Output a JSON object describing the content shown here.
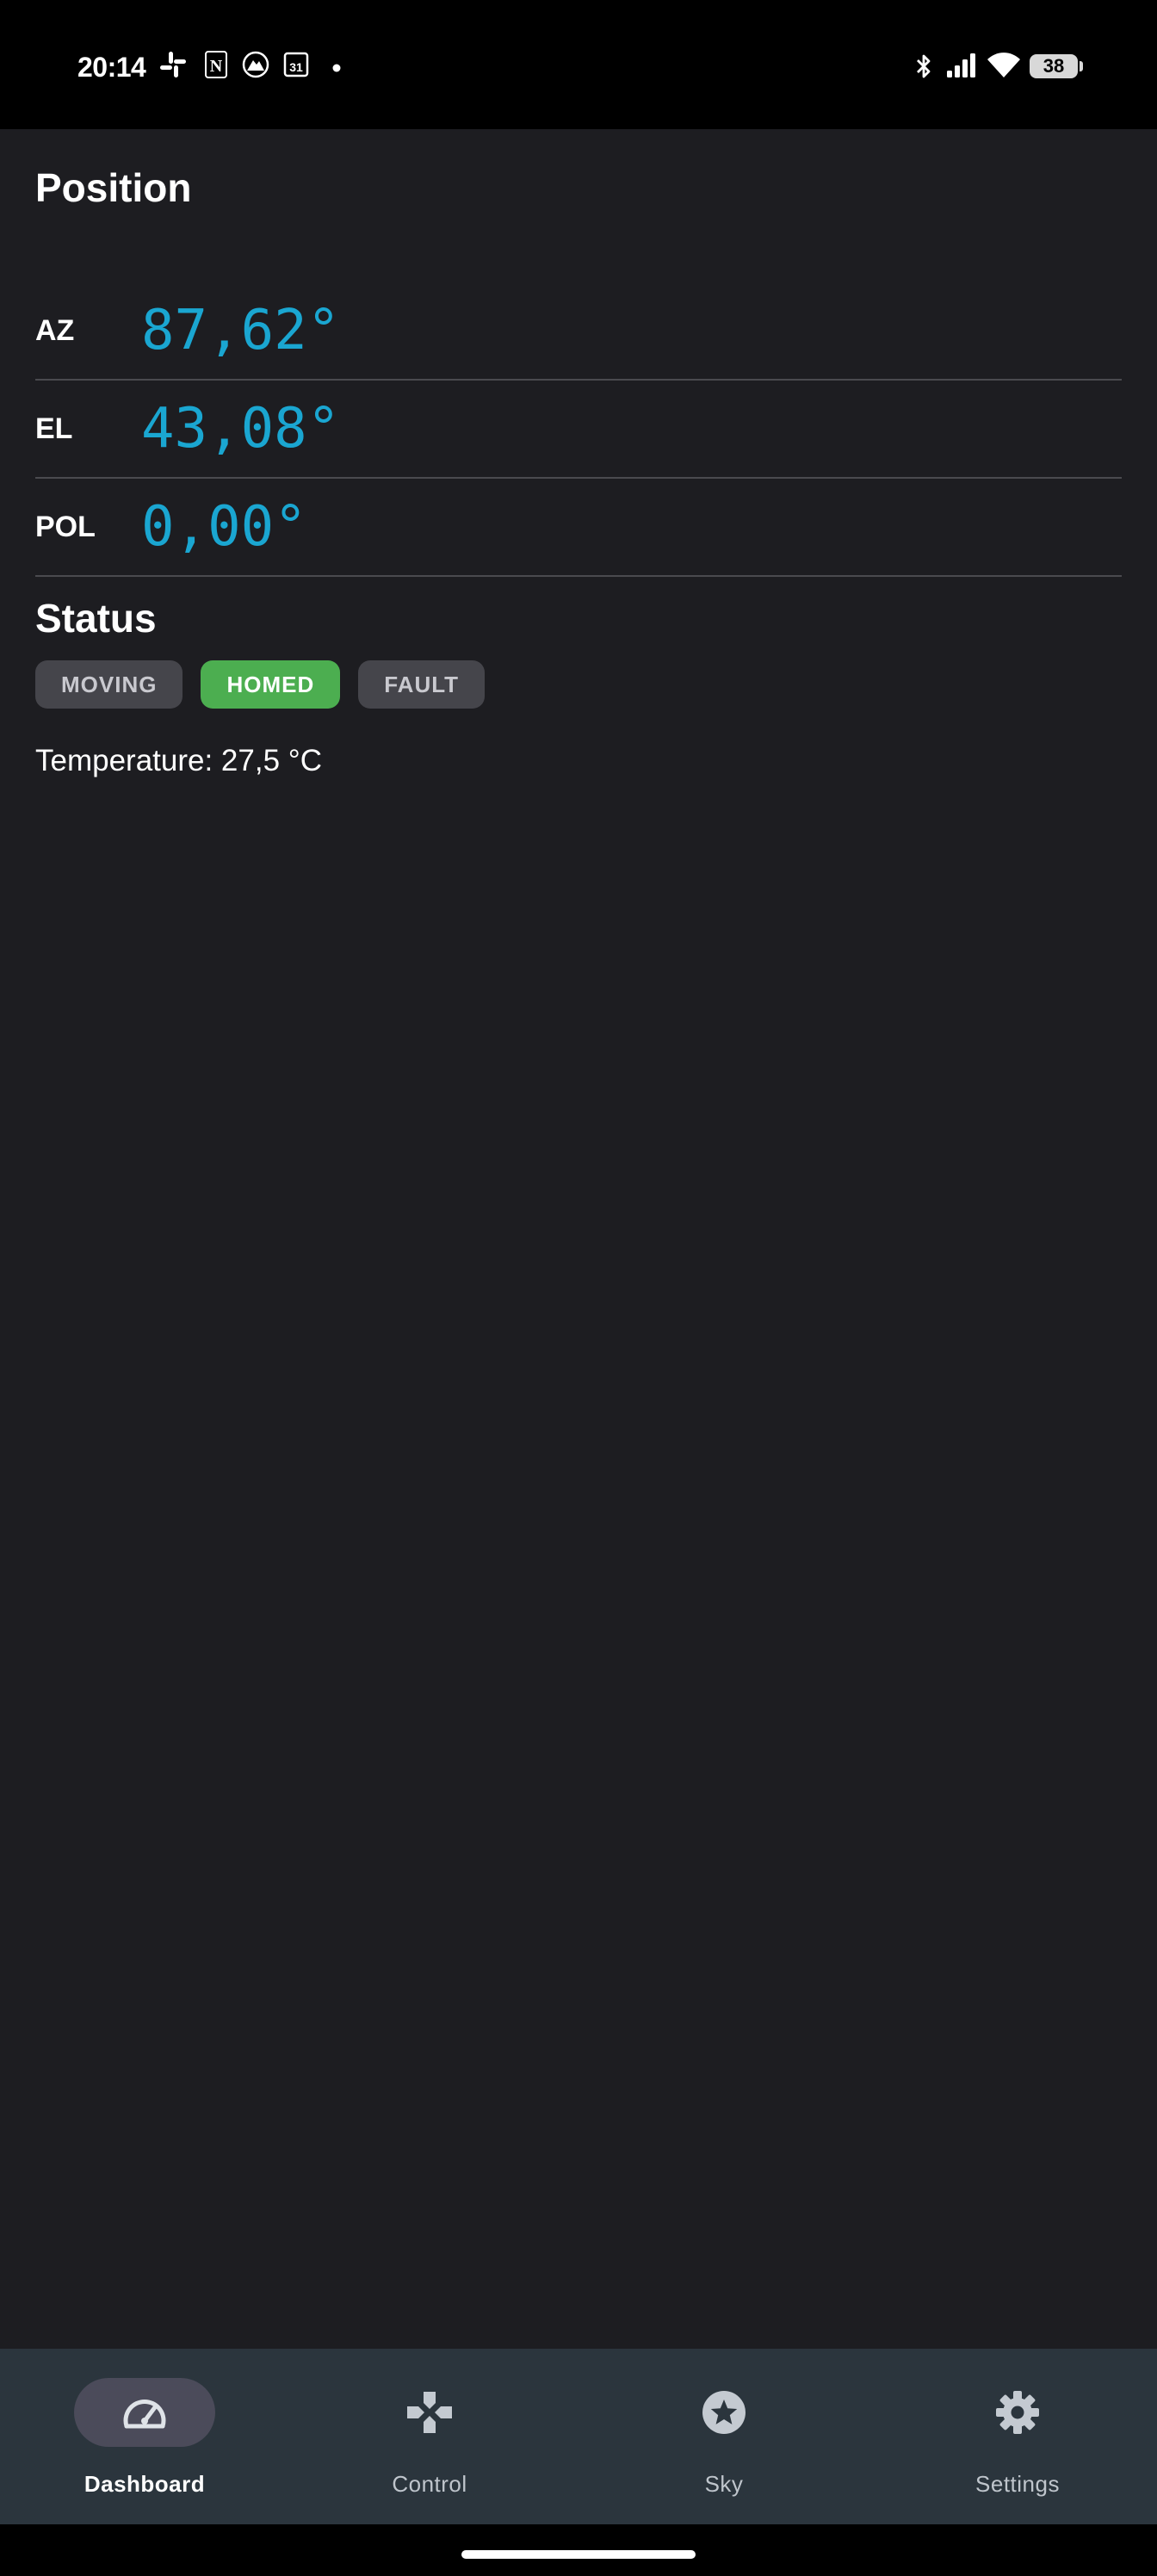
{
  "status_bar": {
    "time": "20:14",
    "notification_icons": [
      "slack-icon",
      "notion-icon",
      "paramount-icon",
      "calendar-icon",
      "dot-icon"
    ],
    "calendar_day": "31",
    "system_icons": [
      "bluetooth-icon",
      "signal-icon",
      "wifi-icon"
    ],
    "battery": "38"
  },
  "position": {
    "title": "Position",
    "rows": [
      {
        "label": "AZ",
        "value": "87,62°"
      },
      {
        "label": "EL",
        "value": "43,08°"
      },
      {
        "label": "POL",
        "value": "0,00°"
      }
    ]
  },
  "status": {
    "title": "Status",
    "chips": [
      {
        "label": "MOVING",
        "active": false
      },
      {
        "label": "HOMED",
        "active": true
      },
      {
        "label": "FAULT",
        "active": false
      }
    ],
    "temperature": "Temperature: 27,5 °C"
  },
  "bottom_nav": {
    "items": [
      {
        "label": "Dashboard",
        "icon": "speedometer-icon",
        "active": true
      },
      {
        "label": "Control",
        "icon": "gamepad-icon",
        "active": false
      },
      {
        "label": "Sky",
        "icon": "star-icon",
        "active": false
      },
      {
        "label": "Settings",
        "icon": "gear-icon",
        "active": false
      }
    ]
  },
  "colors": {
    "background": "#1d1d21",
    "value_accent": "#1aa6d1",
    "chip_active": "#4cae50",
    "chip_inactive": "#45454b",
    "nav_background": "#2b353d",
    "nav_active_pill": "#4b4b5a"
  }
}
